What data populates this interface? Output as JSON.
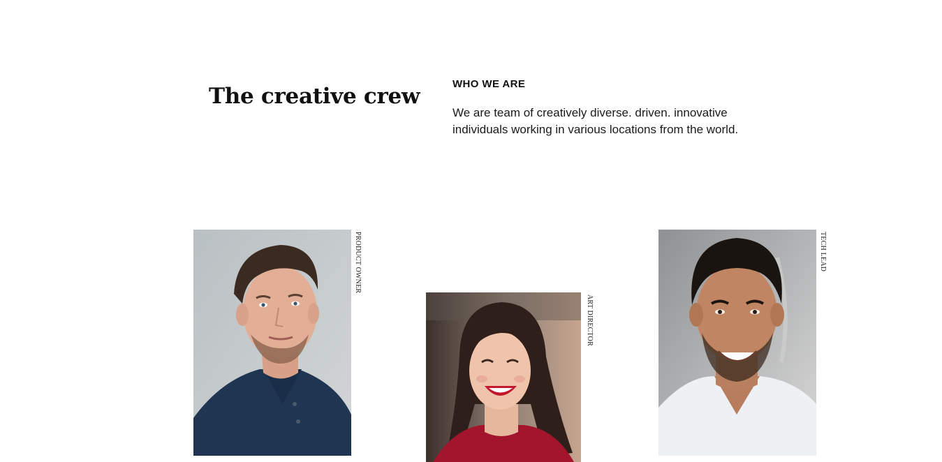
{
  "header": {
    "title": "The creative crew",
    "eyebrow": "WHO WE ARE",
    "intro": "We are team of creatively diverse. driven. innovative individuals working in various locations from the world."
  },
  "team": [
    {
      "role": "PRODUCT OWNER",
      "photo_icon": "man-portrait-navy-polo"
    },
    {
      "role": "ART DIRECTOR",
      "photo_icon": "woman-portrait-red-top"
    },
    {
      "role": "TECH LEAD",
      "photo_icon": "man-portrait-white-tee"
    }
  ],
  "colors": {
    "text": "#111111",
    "background": "#ffffff"
  }
}
